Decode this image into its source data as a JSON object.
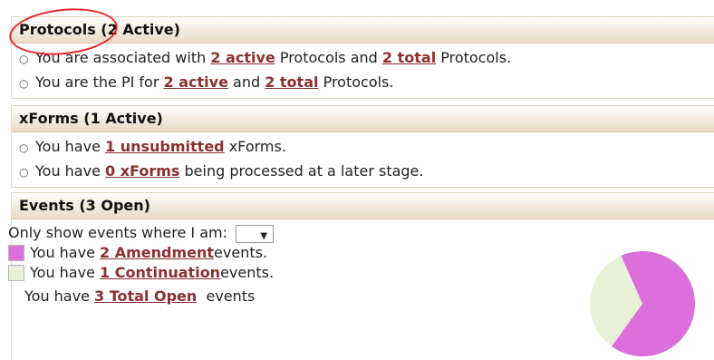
{
  "protocols": {
    "title": "Protocols (2 Active)",
    "line1": {
      "prefix": "You are associated with ",
      "link1": "2 active",
      "middle": " Protocols and ",
      "link2": "2 total",
      "suffix": " Protocols."
    },
    "line2": {
      "prefix": "You are the PI for ",
      "link1": "2 active",
      "middle": " and ",
      "link2": "2 total",
      "suffix": " Protocols."
    }
  },
  "xforms": {
    "title": "xForms (1 Active)",
    "line1": {
      "prefix": "You have ",
      "link": "1 unsubmitted",
      "suffix": " xForms."
    },
    "line2": {
      "prefix": "You have ",
      "link": "0 xForms",
      "suffix": " being processed at a later stage."
    }
  },
  "events": {
    "title": "Events (3 Open)",
    "filter_label": "Only show events where I am:",
    "filter_value": "",
    "amendment": {
      "prefix": "You have ",
      "link": "2 Amendment",
      "suffix": " events.",
      "color": "#dd6fdd"
    },
    "continuation": {
      "prefix": "You have ",
      "link": "1 Continuation",
      "suffix": " events.",
      "color": "#e8f0d8"
    },
    "total": {
      "prefix": "You have ",
      "link": "3 Total Open",
      "suffix": " events"
    }
  },
  "chart_data": {
    "type": "pie",
    "categories": [
      "Amendment",
      "Continuation"
    ],
    "values": [
      2,
      1
    ],
    "colors": [
      "#dd6fdd",
      "#e8f0d8"
    ]
  }
}
